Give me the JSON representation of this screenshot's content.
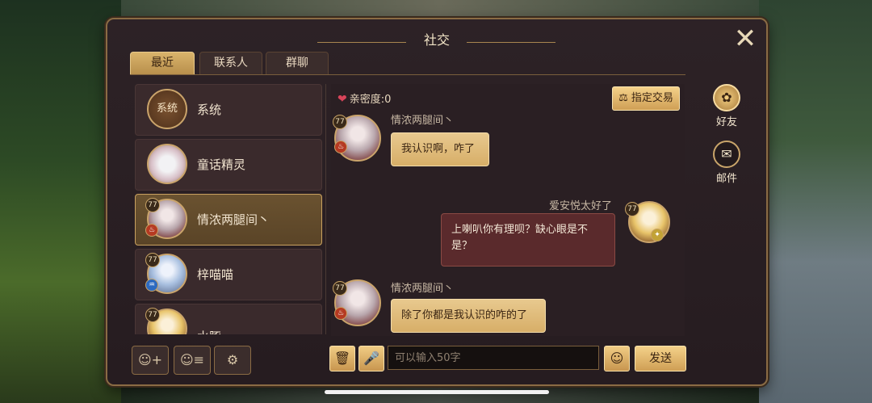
{
  "panel": {
    "title": "社交",
    "close_icon": "close-icon"
  },
  "tabs": [
    {
      "label": "最近",
      "active": true
    },
    {
      "label": "联系人",
      "active": false
    },
    {
      "label": "群聊",
      "active": false
    }
  ],
  "contacts": [
    {
      "name": "系统",
      "avatar_text": "系统",
      "avatar": "system-avatar"
    },
    {
      "name": "童话精灵",
      "avatar": "fairy-avatar"
    },
    {
      "name": "情浓两腿间丶",
      "level": "77",
      "element": "fire",
      "avatar": "player-avatar",
      "selected": true
    },
    {
      "name": "梓喵喵",
      "level": "77",
      "element": "water",
      "avatar": "player-avatar"
    },
    {
      "name": "水豚",
      "level": "77",
      "avatar": "player-avatar"
    }
  ],
  "bottom_toolbar": [
    {
      "icon": "add-friend-icon",
      "glyph": "☺+"
    },
    {
      "icon": "friend-list-icon",
      "glyph": "☺≡"
    },
    {
      "icon": "settings-gear-icon",
      "glyph": "⚙"
    }
  ],
  "chat": {
    "intimacy_label": "亲密度:0",
    "trade_button": "⚖ 指定交易",
    "messages": [
      {
        "sender": "情浓两腿间丶",
        "text": "我认识啊，咋了",
        "direction": "in",
        "level": "77",
        "element": "fire"
      },
      {
        "sender": "爱安悦太好了",
        "text": "上喇叭你有理呗？缺心眼是不是？",
        "direction": "out",
        "level": "77",
        "element": "star"
      },
      {
        "sender": "情浓两腿间丶",
        "text": "除了你都是我认识的咋的了",
        "direction": "in",
        "level": "77",
        "element": "fire"
      }
    ],
    "input_placeholder": "可以输入50字",
    "send_label": "发送",
    "trash_icon": "trash-icon",
    "mic_icon": "microphone-icon",
    "emoji_icon": "emoji-icon"
  },
  "side_nav": [
    {
      "label": "好友",
      "icon": "friends-icon",
      "active": true
    },
    {
      "label": "邮件",
      "icon": "mail-icon",
      "active": false
    }
  ]
}
